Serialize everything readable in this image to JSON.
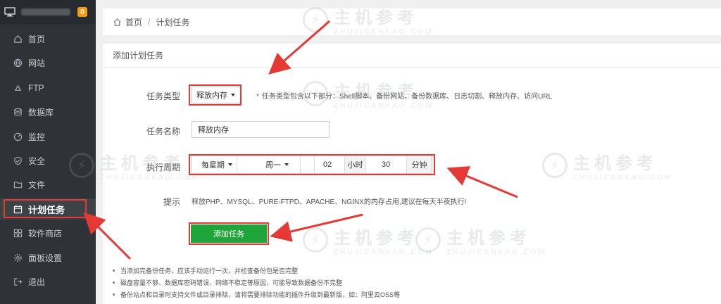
{
  "sidebar": {
    "badge": "0",
    "items": [
      {
        "label": "首页",
        "icon": "home-icon"
      },
      {
        "label": "网站",
        "icon": "globe-icon"
      },
      {
        "label": "FTP",
        "icon": "ftp-icon"
      },
      {
        "label": "数据库",
        "icon": "database-icon"
      },
      {
        "label": "监控",
        "icon": "monitor-icon"
      },
      {
        "label": "安全",
        "icon": "shield-icon"
      },
      {
        "label": "文件",
        "icon": "folder-icon"
      },
      {
        "label": "计划任务",
        "icon": "calendar-icon"
      },
      {
        "label": "软件商店",
        "icon": "store-icon"
      },
      {
        "label": "面板设置",
        "icon": "gear-icon"
      },
      {
        "label": "退出",
        "icon": "logout-icon"
      }
    ],
    "active_index": 7
  },
  "breadcrumb": {
    "home": "首页",
    "separator": "/",
    "current": "计划任务"
  },
  "panel": {
    "title": "添加计划任务",
    "task_type": {
      "label": "任务类型",
      "value": "释放内存",
      "hint": "任务类型包含以下部分：Shell脚本、备份网站、备份数据库、日志切割、释放内存、访问URL"
    },
    "task_name": {
      "label": "任务名称",
      "value": "释放内存"
    },
    "period": {
      "label": "执行周期",
      "cycle": "每星期",
      "weekday": "周一",
      "hour": "02",
      "hour_unit": "小时",
      "minute": "30",
      "minute_unit": "分钟"
    },
    "tip": {
      "label": "提示",
      "text": "释放PHP、MYSQL、PURE-FTPD、APACHE、NGINX的内存占用,建议在每天半夜执行!"
    },
    "submit": "添加任务",
    "notes": [
      "当添加完备份任务，应该手动运行一次，并检查备份包是否完整",
      "磁盘容量不够、数据库密码错误、网络不稳定等原因，可能导致数据备份不完整",
      "备份站点和目录时支持文件或目录排除，请将需要排除功能的插件升级到最新版，如：阿里云OSS等"
    ]
  },
  "watermark": {
    "cn": "主机参考",
    "en": "ZHUJICANKAO.COM"
  },
  "colors": {
    "sidebar_bg": "#2f3338",
    "accent_green": "#20a53a",
    "annotation_red": "#e53935",
    "badge_orange": "#f39c12"
  }
}
